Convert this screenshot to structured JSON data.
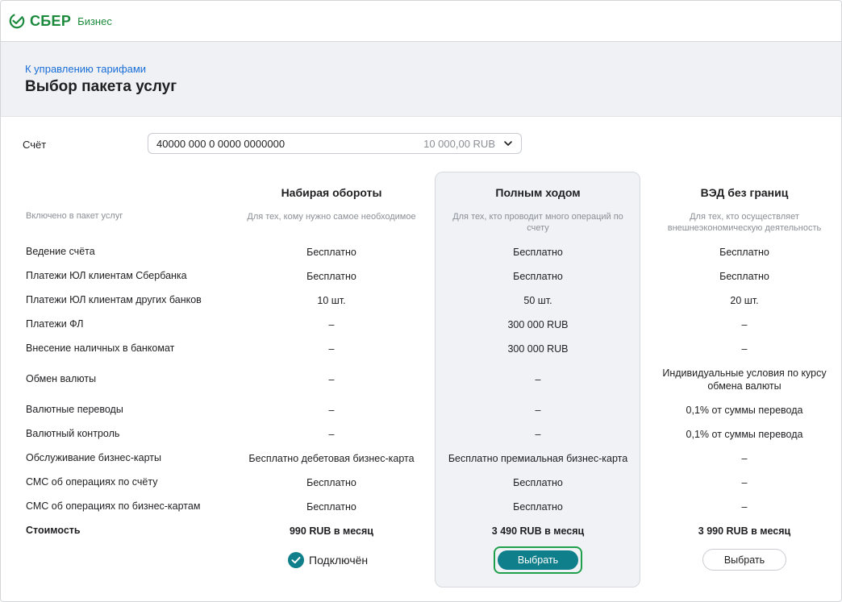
{
  "brand": {
    "name": "СБЕР",
    "sub": "Бизнес",
    "color": "#1b8a3d"
  },
  "header": {
    "back_link": "К управлению тарифами",
    "title": "Выбор пакета услуг"
  },
  "account": {
    "label": "Счёт",
    "number": "40000 000 0 0000 0000000",
    "balance": "10 000,00 RUB"
  },
  "included_label": "Включено в пакет услуг",
  "plans": [
    {
      "title": "Набирая обороты",
      "subtitle": "Для тех, кому нужно самое необходимое"
    },
    {
      "title": "Полным ходом",
      "subtitle": "Для тех, кто проводит много операций по счету"
    },
    {
      "title": "ВЭД без границ",
      "subtitle": "Для тех, кто осуществляет внешнеэкономическую деятельность"
    }
  ],
  "rows": [
    {
      "label": "Ведение счёта",
      "values": [
        "Бесплатно",
        "Бесплатно",
        "Бесплатно"
      ]
    },
    {
      "label": "Платежи ЮЛ клиентам Сбербанка",
      "values": [
        "Бесплатно",
        "Бесплатно",
        "Бесплатно"
      ]
    },
    {
      "label": "Платежи ЮЛ клиентам других банков",
      "values": [
        "10 шт.",
        "50 шт.",
        "20 шт."
      ]
    },
    {
      "label": "Платежи ФЛ",
      "values": [
        "–",
        "300 000 RUB",
        "–"
      ]
    },
    {
      "label": "Внесение наличных в банкомат",
      "values": [
        "–",
        "300 000 RUB",
        "–"
      ]
    },
    {
      "label": "Обмен валюты",
      "values": [
        "–",
        "–",
        "Индивидуальные условия по курсу обмена валюты"
      ]
    },
    {
      "label": "Валютные переводы",
      "values": [
        "–",
        "–",
        "0,1% от суммы перевода"
      ]
    },
    {
      "label": "Валютный контроль",
      "values": [
        "–",
        "–",
        "0,1% от суммы перевода"
      ]
    },
    {
      "label": "Обслуживание бизнес-карты",
      "values": [
        "Бесплатно дебетовая бизнес-карта",
        "Бесплатно премиальная бизнес-карта",
        "–"
      ]
    },
    {
      "label": "СМС об операциях по счёту",
      "values": [
        "Бесплатно",
        "Бесплатно",
        "–"
      ]
    },
    {
      "label": "СМС об операциях по бизнес-картам",
      "values": [
        "Бесплатно",
        "Бесплатно",
        "–"
      ]
    },
    {
      "label": "Стоимость",
      "values": [
        "990 RUB в месяц",
        "3 490 RUB в месяц",
        "3 990 RUB в месяц"
      ]
    }
  ],
  "actions": {
    "connected_label": "Подключён",
    "choose_label": "Выбрать",
    "choose_label_2": "Выбрать"
  },
  "colors": {
    "accent": "#107f8c",
    "focus_ring": "#21a04b",
    "link": "#1a6ed8",
    "check": "#107f8c"
  }
}
